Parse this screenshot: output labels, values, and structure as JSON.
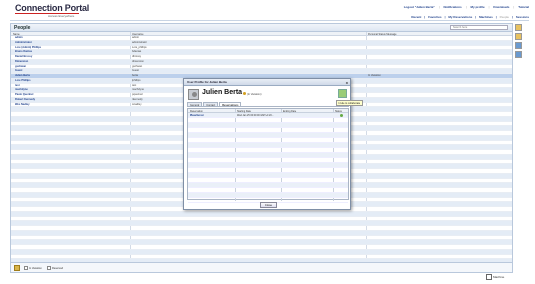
{
  "header": {
    "title": "Connection Portal",
    "subtitle": "Access Everywhere",
    "top_links": [
      "Logout \"Julien Berta\"",
      "Notifications",
      "My profile",
      "Downloads",
      "Tutorial"
    ],
    "nav_links": [
      "Recent",
      "Favorites",
      "My Reservations",
      "Machines",
      "People",
      "Sessions"
    ],
    "nav_active": "People"
  },
  "people": {
    "title": "People",
    "search_placeholder": "Search here",
    "columns": {
      "name": "Name",
      "username": "Username",
      "status": "Personal Status Message"
    },
    "rows": [
      {
        "name": "admin",
        "username": "admin",
        "status": ""
      },
      {
        "name": "Administrator",
        "username": "administrator",
        "status": ""
      },
      {
        "name": "Lore (Admin) Phillips",
        "username": "Lore_phillips",
        "status": ""
      },
      {
        "name": "Bruno Dantas",
        "username": "bdantas",
        "status": ""
      },
      {
        "name": "Daniel Brossy",
        "username": "dbrossy",
        "status": ""
      },
      {
        "name": "Dimension",
        "username": "dimension",
        "status": ""
      },
      {
        "name": "gschwan",
        "username": "gschwan",
        "status": ""
      },
      {
        "name": "Guest",
        "username": "Guest",
        "status": ""
      },
      {
        "name": "Julien Berta",
        "username": "berta",
        "status": "In Vacation"
      },
      {
        "name": "Lore Phillips",
        "username": "lphillips",
        "status": ""
      },
      {
        "name": "test",
        "username": "test",
        "status": ""
      },
      {
        "name": "machdyne",
        "username": "machdyne",
        "status": ""
      },
      {
        "name": "Paulo Querinel",
        "username": "pquerinel",
        "status": ""
      },
      {
        "name": "Robert Kennedy",
        "username": "rkennedy",
        "status": ""
      },
      {
        "name": "Wes Nadley",
        "username": "wnadley",
        "status": ""
      }
    ],
    "selected_index": 8,
    "footer": {
      "opt1": "In Vacation",
      "opt2": "Reserved"
    }
  },
  "modal": {
    "title": "User Profile for Julien Berta",
    "close_symbol": "x",
    "name": "Julien Berta",
    "location": "(In Vacation)",
    "tooltip": "Invite to collaborate",
    "tabs": [
      "General",
      "Contact",
      "Reservations"
    ],
    "active_tab": 2,
    "table": {
      "headers": [
        "Reservation",
        "Starting Date",
        "Ending Date",
        "Status"
      ],
      "rows": [
        {
          "reservation": "lBaseServer",
          "start": "Wed Jan 25 00:00:00 GMT+0 20...",
          "end": ""
        }
      ]
    },
    "close_label": "Close"
  },
  "bottom": {
    "label": "Machine"
  },
  "colors": {
    "accent": "#1d3f8a",
    "logo_rule": "#cc2222",
    "row_alt": "#e4ecf6",
    "row_selected": "#bcd0ec"
  }
}
